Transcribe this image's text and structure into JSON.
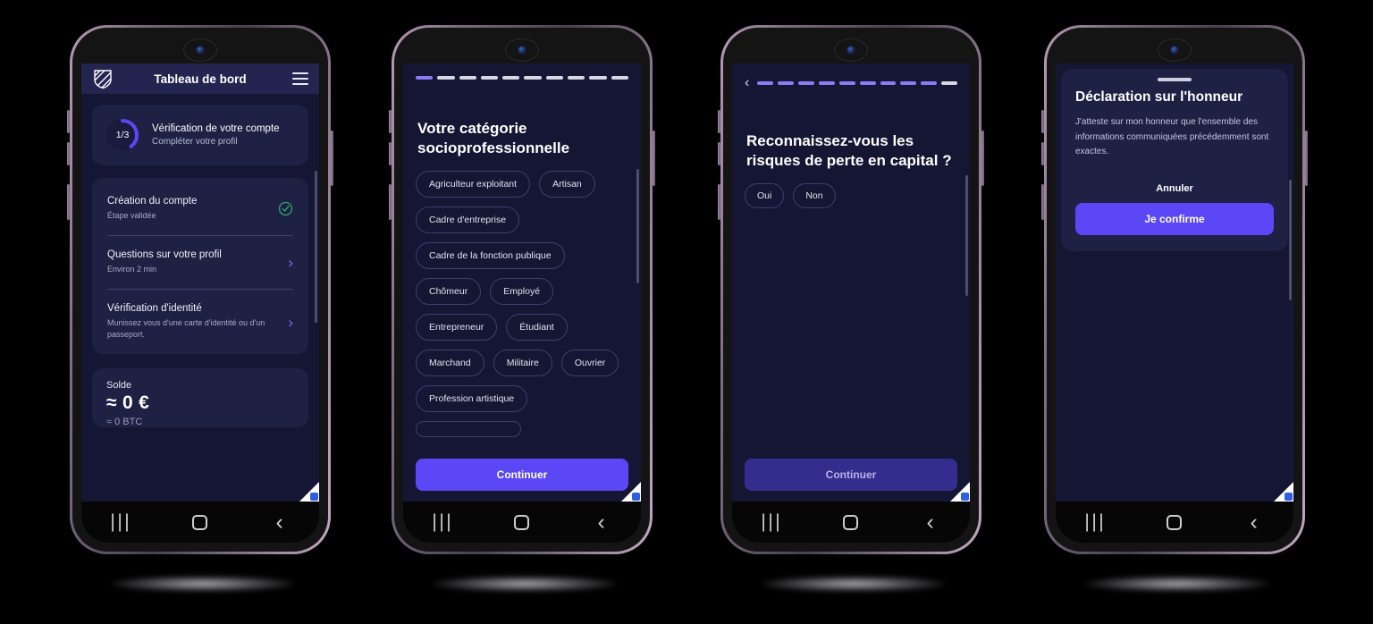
{
  "phones": [
    {
      "id": "dashboard",
      "appbar": {
        "title": "Tableau de bord",
        "logo_icon": "shield-logo-icon",
        "menu_icon": "hamburger-menu-icon"
      },
      "verification_card": {
        "progress_label": "1/3",
        "title": "Vérification de votre compte",
        "subtitle": "Compléter votre profil",
        "progress_value": 33
      },
      "steps": [
        {
          "title": "Création du compte",
          "subtitle": "Étape validée",
          "trailing_icon": "check-circle-icon",
          "state": "done"
        },
        {
          "title": "Questions sur votre profil",
          "subtitle": "Environ 2 min",
          "trailing_icon": "chevron-right-icon",
          "state": "todo"
        },
        {
          "title": "Vérification d'identité",
          "subtitle": "Munissez vous d'une carte d'identité ou d'un passeport.",
          "trailing_icon": "chevron-right-icon",
          "state": "todo"
        }
      ],
      "balance": {
        "label": "Solde",
        "value": "≈ 0 €",
        "sub": "≈ 0 BTC"
      }
    },
    {
      "id": "category-step",
      "progress": {
        "total": 10,
        "current": 1,
        "has_back": false
      },
      "question": "Votre catégorie socioprofessionnelle",
      "options": [
        "Agriculteur exploitant",
        "Artisan",
        "Cadre d'entreprise",
        "Cadre de la fonction publique",
        "Chômeur",
        "Employé",
        "Entrepreneur",
        "Étudiant",
        "Marchand",
        "Militaire",
        "Ouvrier",
        "Profession artistique"
      ],
      "cta": {
        "label": "Continuer",
        "disabled": false
      }
    },
    {
      "id": "risk-step",
      "progress": {
        "total": 10,
        "current": 9,
        "has_back": true,
        "back_icon": "chevron-left-icon"
      },
      "question": "Reconnaissez-vous les risques de perte en capital ?",
      "options": [
        "Oui",
        "Non"
      ],
      "cta": {
        "label": "Continuer",
        "disabled": true
      }
    },
    {
      "id": "declaration-sheet",
      "sheet": {
        "grabber": "drag-handle",
        "title": "Déclaration sur l'honneur",
        "body": "J'atteste sur mon honneur que l'ensemble des informations communiquées précédemment sont exactes.",
        "cancel_label": "Annuler",
        "confirm_label": "Je confirme"
      }
    }
  ],
  "navbar": {
    "recents_icon": "recents-icon",
    "home_icon": "home-icon",
    "back_icon": "back-icon"
  },
  "watermark": {
    "badge_glyph": "▮"
  },
  "colors": {
    "accent": "#5b47f5",
    "accent_light": "#8c7bf5",
    "screen_bg": "#151633",
    "card_bg": "#1e2044",
    "appbar_bg": "#232450",
    "success": "#2fa866",
    "chevron": "#7b6ef0"
  }
}
